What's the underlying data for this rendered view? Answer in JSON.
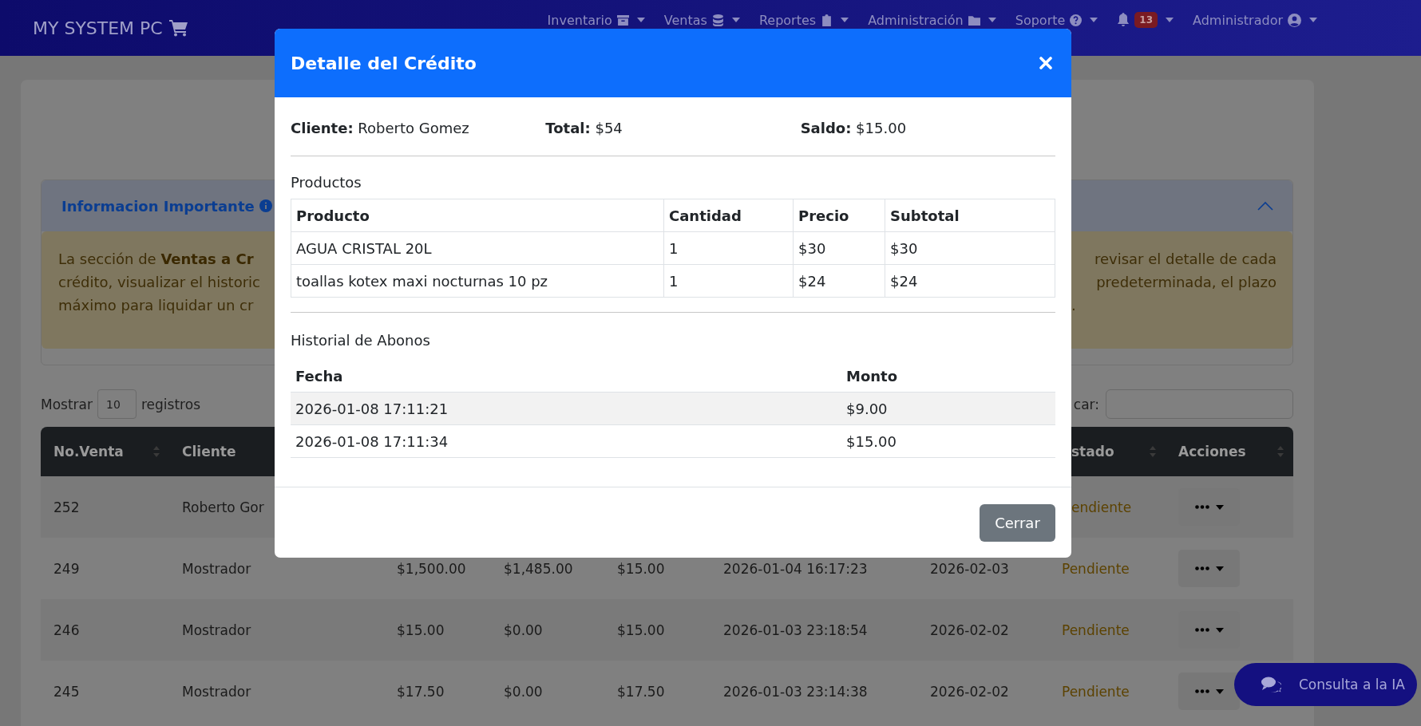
{
  "navbar": {
    "brand": "MY SYSTEM PC",
    "menus": [
      {
        "label": "Inventario"
      },
      {
        "label": "Ventas"
      },
      {
        "label": "Reportes"
      },
      {
        "label": "Administración"
      },
      {
        "label": "Soporte"
      }
    ],
    "notifications": {
      "count": "13"
    },
    "user": {
      "label": "Administrador"
    }
  },
  "info_panel": {
    "title": "Informacion Importante",
    "expanded": true,
    "text_left": [
      "La sección de **Ventas a Cr**",
      "crédito, visualizar el historic",
      "máximo para liquidar un cr"
    ],
    "text_right": [
      "revisar el detalle de cada",
      "predeterminada, el plazo",
      "."
    ]
  },
  "length_control": {
    "label_before": "Mostrar",
    "value": "10",
    "label_after": "registros"
  },
  "search": {
    "label": "car:"
  },
  "table": {
    "columns": [
      {
        "label": "No.Venta"
      },
      {
        "label": "Cliente"
      },
      {
        "label": "stado"
      },
      {
        "label": "Acciones"
      }
    ],
    "rows": [
      {
        "no_venta": "252",
        "cliente": "Roberto Gor",
        "estado": "endiente"
      },
      {
        "no_venta": "249",
        "cliente": "Mostrador",
        "column_3": "$1,500.00",
        "column_4": "$1,485.00",
        "column_5": "$15.00",
        "column_6": "2026-01-04 16:17:23",
        "column_7": "2026-02-03",
        "estado": "Pendiente"
      },
      {
        "no_venta": "246",
        "cliente": "Mostrador",
        "column_3": "$15.00",
        "column_4": "$0.00",
        "column_5": "$15.00",
        "column_6": "2026-01-03 23:18:54",
        "column_7": "2026-02-02",
        "estado": "Pendiente"
      },
      {
        "no_venta": "245",
        "cliente": "Mostrador",
        "column_3": "$17.50",
        "column_4": "$0.00",
        "column_5": "$17.50",
        "column_6": "2026-01-03 23:14:38",
        "column_7": "2026-02-02",
        "estado": "Pendiente"
      }
    ]
  },
  "chat_button": {
    "label": "Consulta a la IA"
  },
  "modal": {
    "title": "Detalle del Crédito",
    "summary": [
      "**Cliente:** Roberto Gomez",
      "**Total:** $54",
      "**Saldo:** $15.00"
    ],
    "products": {
      "heading": "Productos",
      "columns": [
        "Producto",
        "Cantidad",
        "Precio",
        "Subtotal"
      ],
      "rows": [
        [
          "AGUA CRISTAL 20L",
          "1",
          "$30",
          "$30"
        ],
        [
          "toallas kotex maxi nocturnas 10 pz",
          "1",
          "$24",
          "$24"
        ]
      ]
    },
    "payments": {
      "heading": "Historial de Abonos",
      "columns": [
        "Fecha",
        "Monto"
      ],
      "rows": [
        [
          "2026-01-08 17:11:21",
          "$9.00"
        ],
        [
          "2026-01-08 17:11:34",
          "$15.00"
        ]
      ]
    },
    "close_button": "Cerrar"
  }
}
